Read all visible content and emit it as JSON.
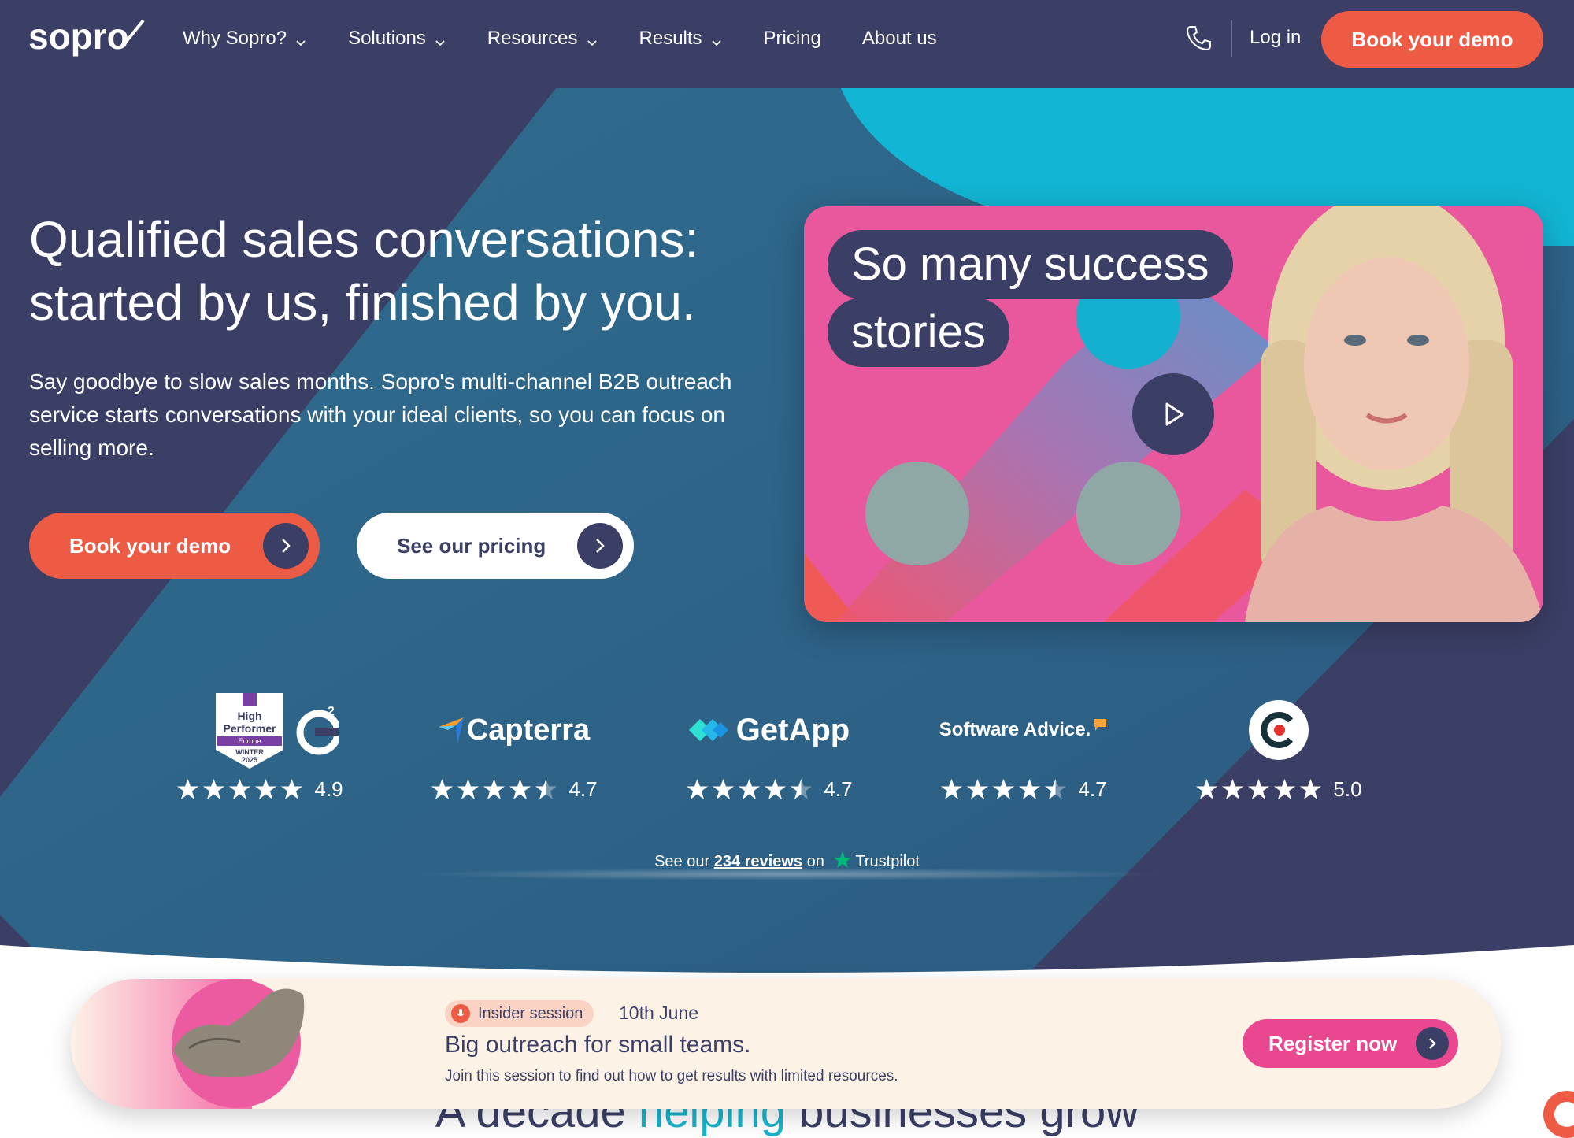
{
  "header": {
    "logo_text": "sopro",
    "nav": [
      {
        "label": "Why Sopro?",
        "has_dropdown": true
      },
      {
        "label": "Solutions",
        "has_dropdown": true
      },
      {
        "label": "Resources",
        "has_dropdown": true
      },
      {
        "label": "Results",
        "has_dropdown": true
      },
      {
        "label": "Pricing",
        "has_dropdown": false
      },
      {
        "label": "About us",
        "has_dropdown": false
      }
    ],
    "login_label": "Log in",
    "cta_label": "Book your demo"
  },
  "hero": {
    "title": "Qualified sales conversations: started by us, finished by you.",
    "subtitle": "Say goodbye to slow sales months. Sopro's multi-channel B2B outreach service starts conversations with your ideal clients, so you can focus on selling more.",
    "primary_button": "Book your demo",
    "secondary_button": "See our pricing",
    "video": {
      "bubble_line1": "So many success",
      "bubble_line2": "stories"
    }
  },
  "ratings": [
    {
      "platform": "G2",
      "badge_line1": "High",
      "badge_line2": "Performer",
      "badge_region": "Europe",
      "badge_season": "WINTER",
      "badge_year": "2025",
      "score": "4.9",
      "stars": 5
    },
    {
      "platform": "Capterra",
      "score": "4.7",
      "stars": 4.5
    },
    {
      "platform": "GetApp",
      "score": "4.7",
      "stars": 4.5
    },
    {
      "platform": "Software Advice.",
      "score": "4.7",
      "stars": 4.5
    },
    {
      "platform": "Clutch",
      "score": "5.0",
      "stars": 5
    }
  ],
  "trustpilot": {
    "prefix": "See our",
    "link": "234 reviews",
    "middle": "on",
    "brand": "Trustpilot"
  },
  "banner": {
    "chip_label": "Insider session",
    "date": "10th June",
    "title": "Big outreach for small teams.",
    "description": "Join this session to find out how to get results with limited resources.",
    "register_label": "Register now"
  },
  "section": {
    "heading_part1": "A decade",
    "heading_highlight": "helping",
    "heading_part2": "businesses grow"
  },
  "colors": {
    "navy": "#3b3f66",
    "coral": "#ee5b45",
    "cyan": "#12b5d3",
    "pink": "#e9589d"
  }
}
